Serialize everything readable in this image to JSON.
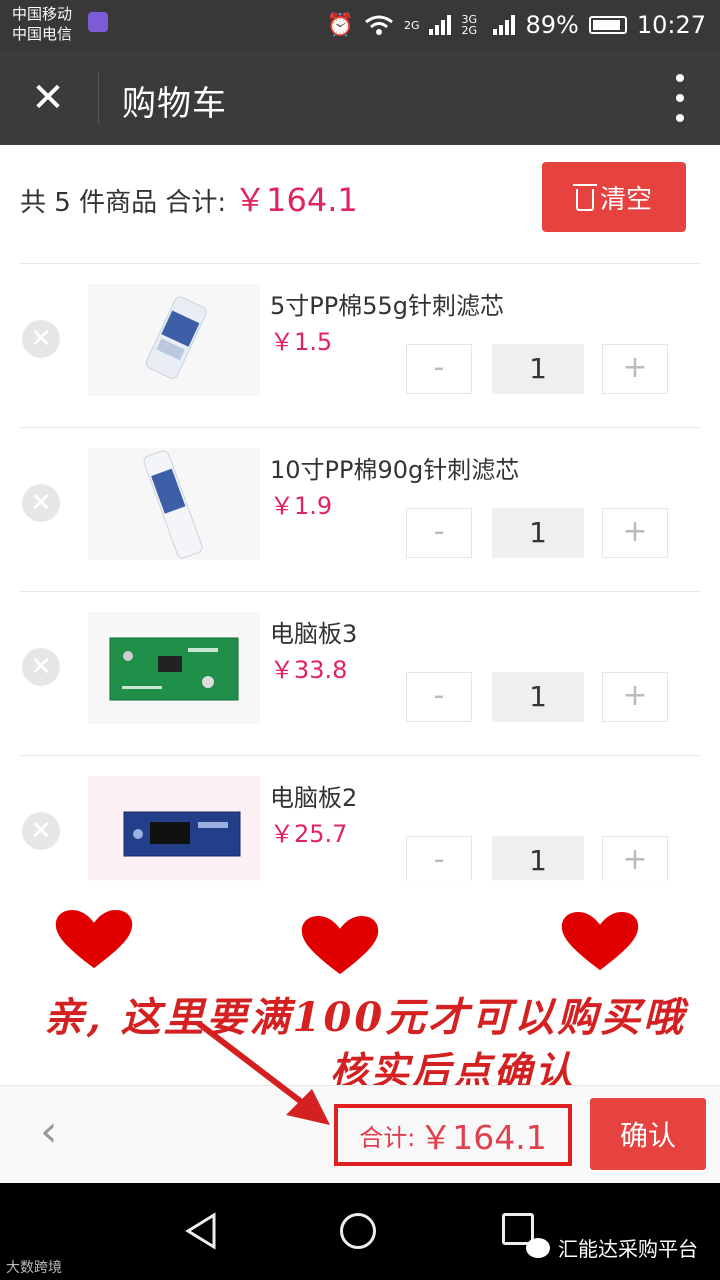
{
  "status_bar": {
    "carrier_1": "中国移动",
    "carrier_2": "中国电信",
    "network_1": "2G",
    "network_2": "3G 2G",
    "battery": "89%",
    "time": "10:27",
    "icons": [
      "alarm-icon",
      "wifi-icon",
      "signal-icon",
      "battery-icon"
    ]
  },
  "header": {
    "title": "购物车",
    "close_icon": "close-icon",
    "menu_icon": "more-vertical-icon"
  },
  "summary": {
    "prefix": "共 5 件商品  合计:",
    "total": "￥164.1",
    "clear_label": "清空"
  },
  "items": [
    {
      "name": "5寸PP棉55g针刺滤芯",
      "price": "￥1.5",
      "qty": "1"
    },
    {
      "name": "10寸PP棉90g针刺滤芯",
      "price": "￥1.9",
      "qty": "1"
    },
    {
      "name": "电脑板3",
      "price": "￥33.8",
      "qty": "1"
    },
    {
      "name": "电脑板2",
      "price": "￥25.7",
      "qty": "1"
    }
  ],
  "qty_controls": {
    "minus": "-",
    "plus": "+"
  },
  "bottom_bar": {
    "total_label": "合计:",
    "total": "￥164.1",
    "confirm_label": "确认"
  },
  "annotation": {
    "line1": "亲, 这里要满100元才可以购买哦",
    "line2": "核实后点确认"
  },
  "watermarks": {
    "left": "大数跨境",
    "right": "汇能达采购平台"
  },
  "colors": {
    "accent_red": "#e64340",
    "price_red": "#e0245e",
    "header_bg": "#3b3b3b",
    "annotation_red": "#d42020"
  }
}
